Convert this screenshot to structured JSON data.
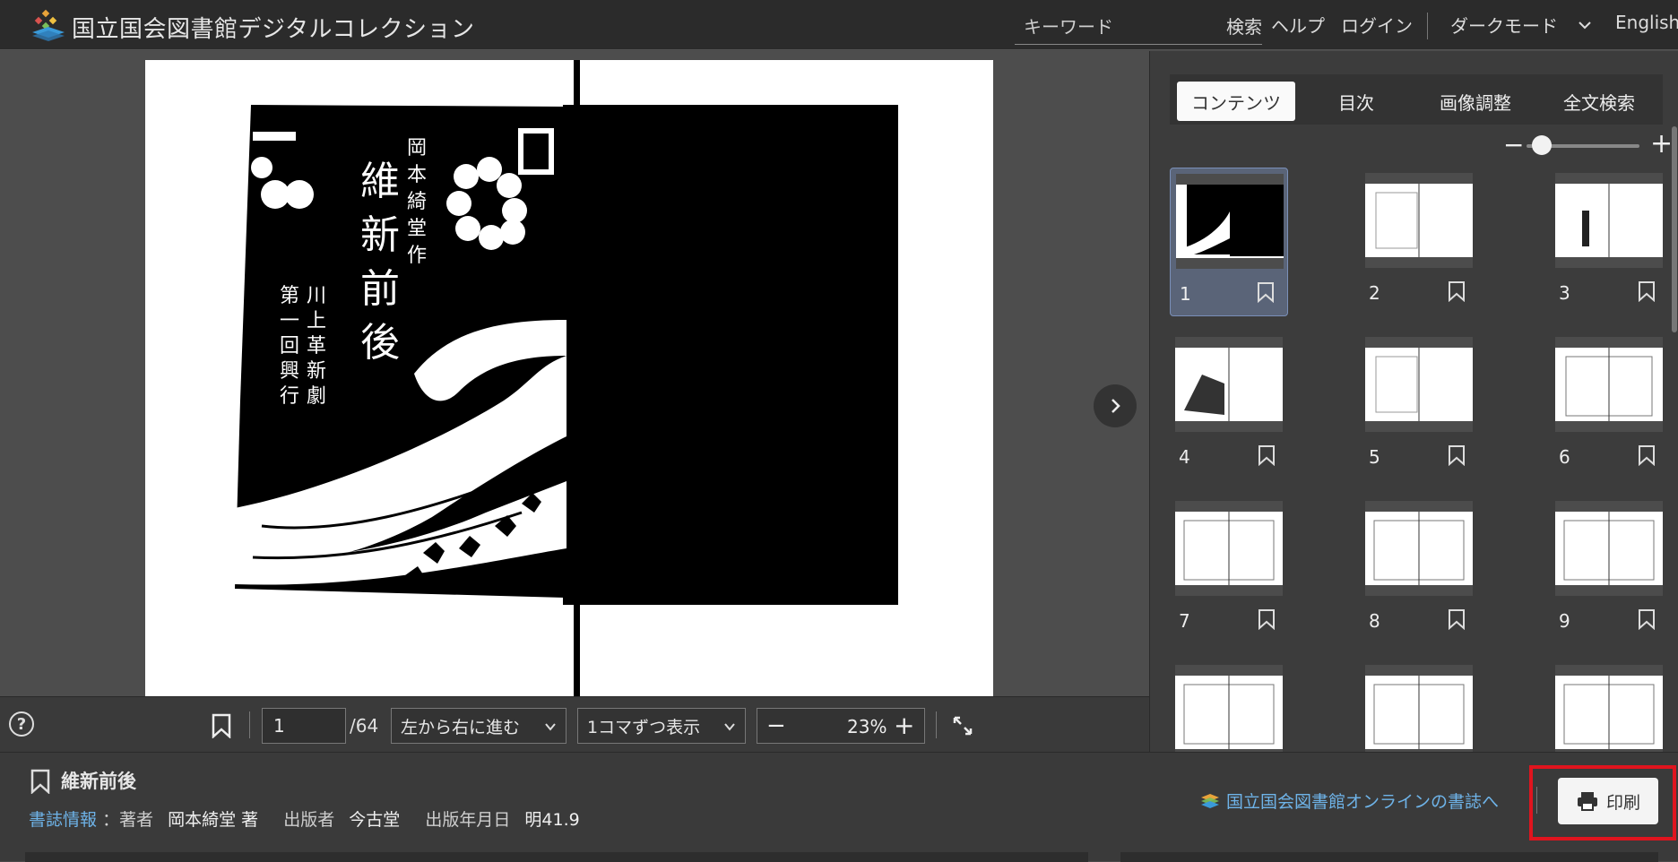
{
  "header": {
    "site_title": "国立国会図書館デジタルコレクション",
    "search_placeholder": "キーワード",
    "search_button": "検索",
    "help": "ヘルプ",
    "login": "ログイン",
    "dark_mode": "ダークモード",
    "language": "English"
  },
  "viewer": {
    "page_current": "1",
    "page_total": "/64",
    "direction": "左から右に進む",
    "display_mode": "1コマずつ表示",
    "zoom_value": "23",
    "zoom_unit": "%"
  },
  "side_panel": {
    "tabs": [
      "コンテンツ",
      "目次",
      "画像調整",
      "全文検索"
    ],
    "active_tab": "コンテンツ",
    "thumbnails": [
      "1",
      "2",
      "3",
      "4",
      "5",
      "6",
      "7",
      "8",
      "9"
    ],
    "selected_thumbnail": "1"
  },
  "info": {
    "title": "維新前後",
    "bib_link": "書誌情報",
    "author_label": "：著者",
    "author": "岡本綺堂 著",
    "publisher_label": "出版者",
    "publisher": "今古堂",
    "date_label": "出版年月日",
    "date": "明41.9",
    "ndl_link": "国立国会図書館オンラインの書誌へ",
    "print": "印刷"
  },
  "colors": {
    "accent_link": "#6eb3e8",
    "highlight": "#e0141e",
    "selected_thumb": "#5a6478"
  }
}
